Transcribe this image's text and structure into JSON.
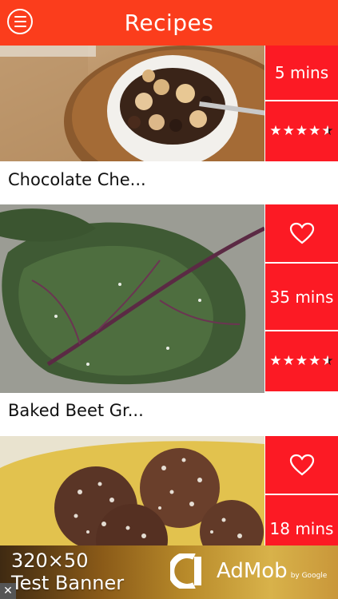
{
  "header": {
    "title": "Recipes",
    "menu_icon": "hamburger-menu-icon"
  },
  "recipes": [
    {
      "name": "Chocolate Che...",
      "time": "5 mins",
      "rating": 4.5,
      "favorite_icon": "heart-outline-icon"
    },
    {
      "name": "Baked Beet Gr...",
      "time": "35 mins",
      "rating": 4.5,
      "favorite_icon": "heart-outline-icon"
    },
    {
      "name": "",
      "time": "18 mins",
      "rating": null,
      "favorite_icon": "heart-outline-icon"
    }
  ],
  "ad": {
    "line1": "320×50",
    "line2": "Test Banner",
    "brand": "AdMob",
    "brand_sub": "by Google",
    "close_icon": "close-icon"
  },
  "colors": {
    "header_bg": "#fb3d1c",
    "tile_bg": "#fc1a24",
    "text_dark": "#111111"
  }
}
